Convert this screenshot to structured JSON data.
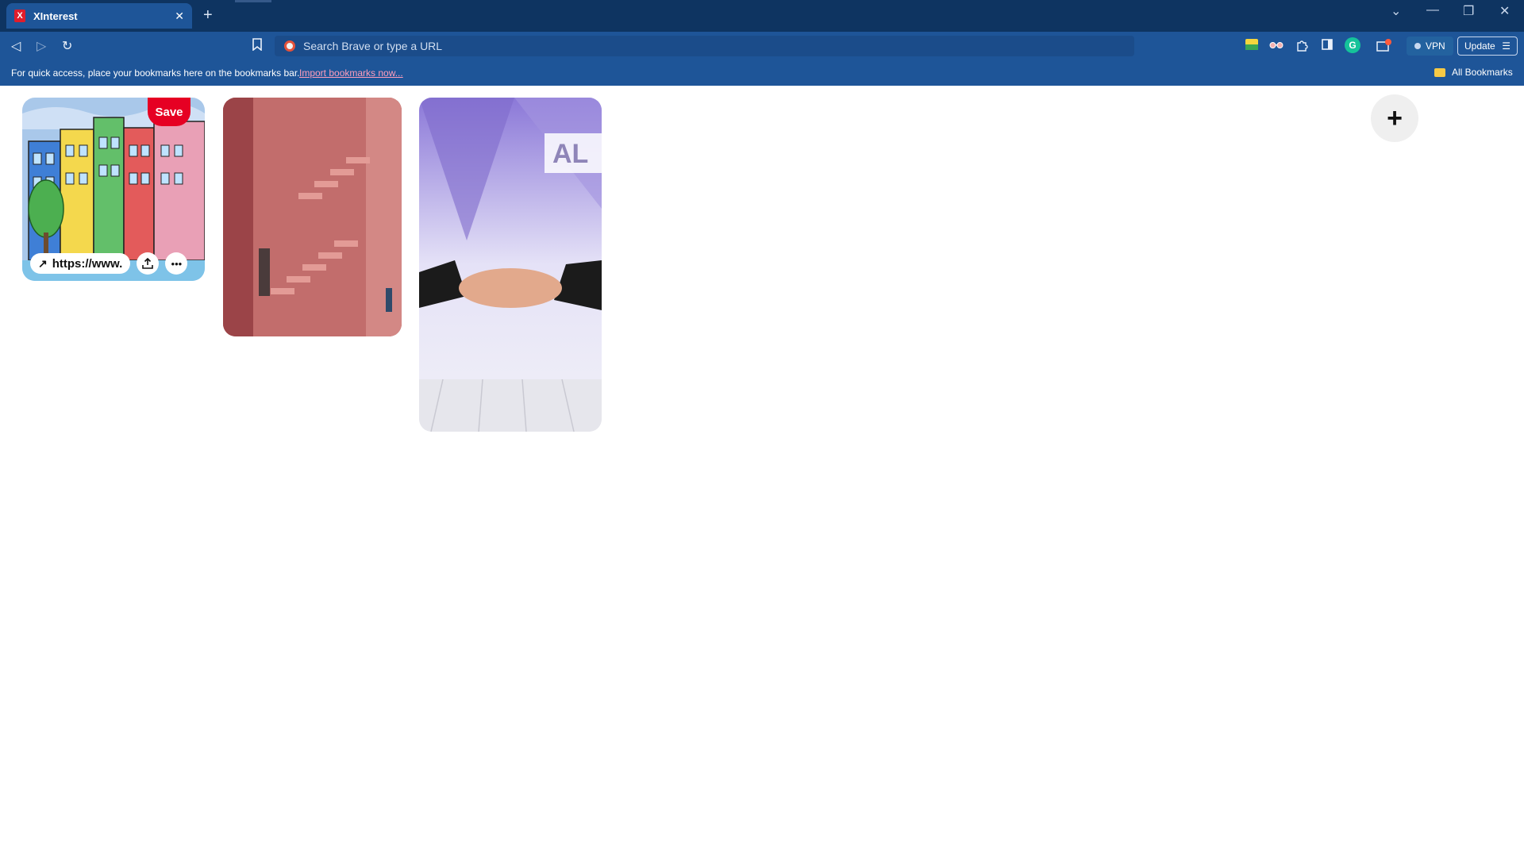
{
  "browser": {
    "tab": {
      "title": "XInterest",
      "favicon": "X",
      "close_icon": "close-icon"
    },
    "new_tab_label": "+",
    "window_controls": {
      "dropdown": "chevron-down-icon",
      "minimize": "—",
      "restore": "❐",
      "close": "✕"
    },
    "nav": {
      "back": "◁",
      "forward": "▷",
      "reload": "↻"
    },
    "omnibox": {
      "placeholder": "Search Brave or type a URL"
    },
    "vpn_label": "VPN",
    "update_label": "Update",
    "bookmarks_bar": {
      "message": "For quick access, place your bookmarks here on the bookmarks bar.",
      "import_link": "Import bookmarks now...",
      "all_bookmarks": "All Bookmarks"
    }
  },
  "pins": [
    {
      "id": "colorful-houses",
      "save_label": "Save",
      "url_label": "https://www.",
      "share_icon": "upload-icon",
      "more_icon": "more-icon"
    },
    {
      "id": "pink-stairs"
    },
    {
      "id": "handshake",
      "image_text": "AL"
    }
  ],
  "fab": {
    "label": "+"
  },
  "colors": {
    "titlebar": "#0e3461",
    "toolbar": "#1e5598",
    "save_red": "#e60023",
    "link_pink": "#ff9dbb"
  }
}
